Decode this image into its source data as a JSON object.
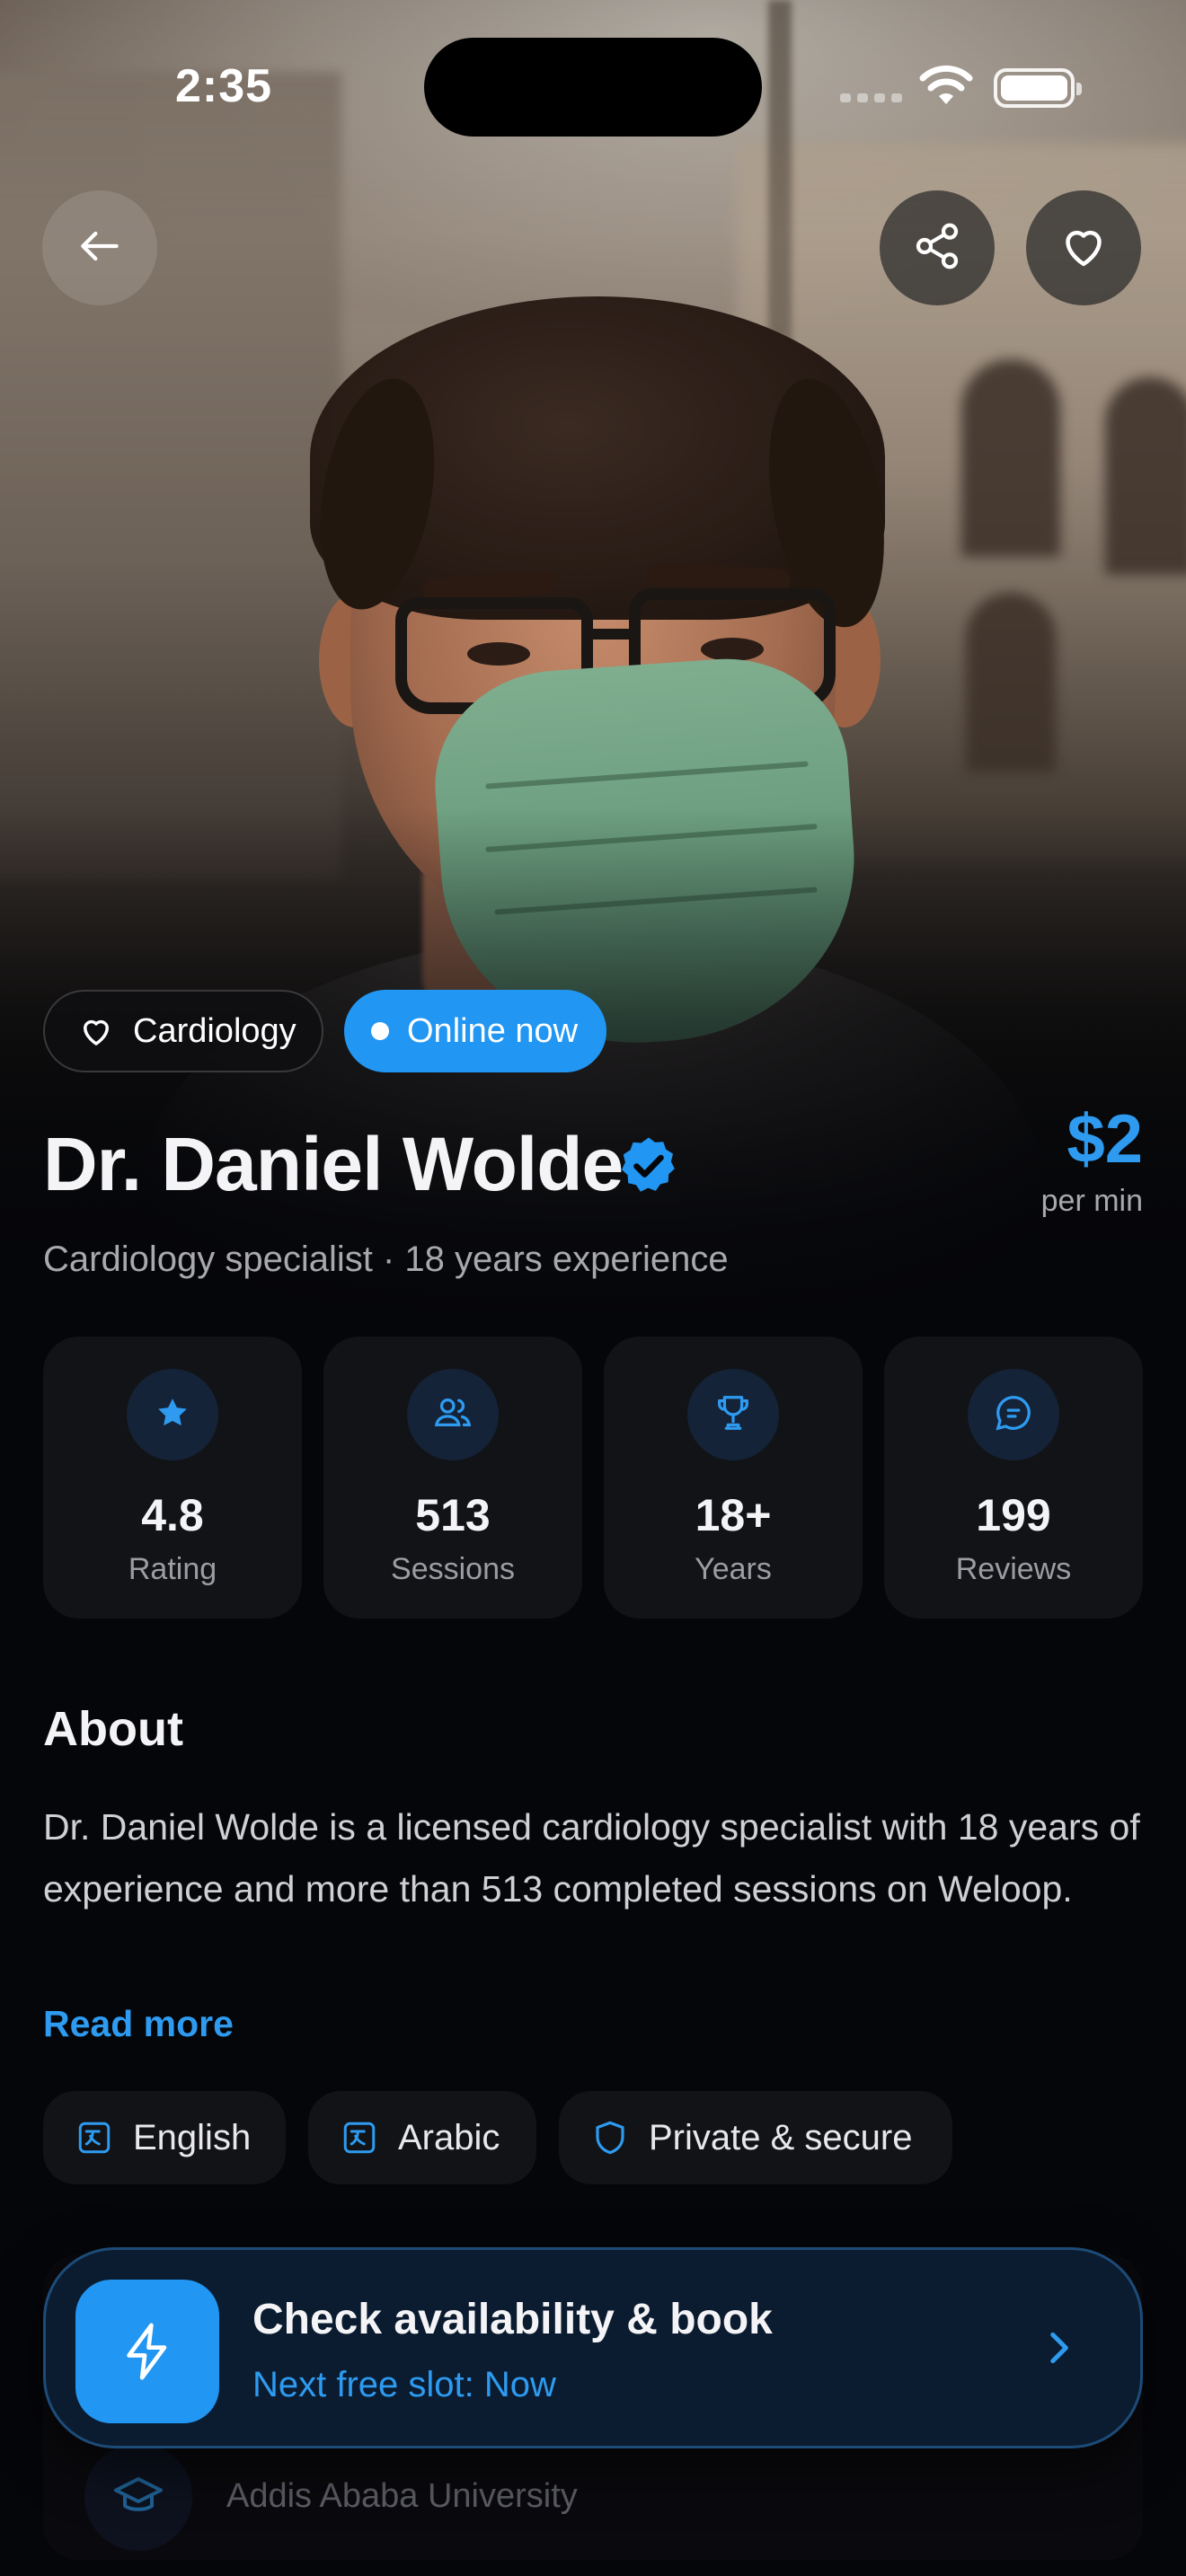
{
  "status_bar": {
    "time": "2:35"
  },
  "hero": {
    "photo": "doctor-portrait-photo"
  },
  "header": {
    "back_icon": "arrow-left-icon",
    "share_icon": "share-icon",
    "favorite_icon": "heart-icon"
  },
  "chips": {
    "specialty": "Cardiology",
    "status": "Online now"
  },
  "doctor": {
    "name": "Dr. Daniel Wolde",
    "verified": true,
    "subtitle": "Cardiology specialist · 18 years experience",
    "price": "$2",
    "price_unit": "per min"
  },
  "stats": [
    {
      "icon": "star-icon",
      "value": "4.8",
      "label": "Rating"
    },
    {
      "icon": "users-icon",
      "value": "513",
      "label": "Sessions"
    },
    {
      "icon": "trophy-icon",
      "value": "18+",
      "label": "Years"
    },
    {
      "icon": "message-icon",
      "value": "199",
      "label": "Reviews"
    }
  ],
  "about": {
    "title": "About",
    "body": "Dr. Daniel Wolde is a licensed cardiology specialist with 18 years of experience and more than 513 completed sessions on Weloop.",
    "read_more": "Read more"
  },
  "tags": [
    {
      "icon": "translate-icon",
      "label": "English"
    },
    {
      "icon": "translate-icon",
      "label": "Arabic"
    },
    {
      "icon": "shield-icon",
      "label": "Private & secure"
    }
  ],
  "education": {
    "institution": "Addis Ababa University"
  },
  "cta": {
    "title": "Check availability & book",
    "subtitle": "Next free slot: Now"
  },
  "colors": {
    "accent": "#2196f3",
    "accent_text": "#2e9bf0",
    "background": "#05060a",
    "card": "#121316"
  }
}
